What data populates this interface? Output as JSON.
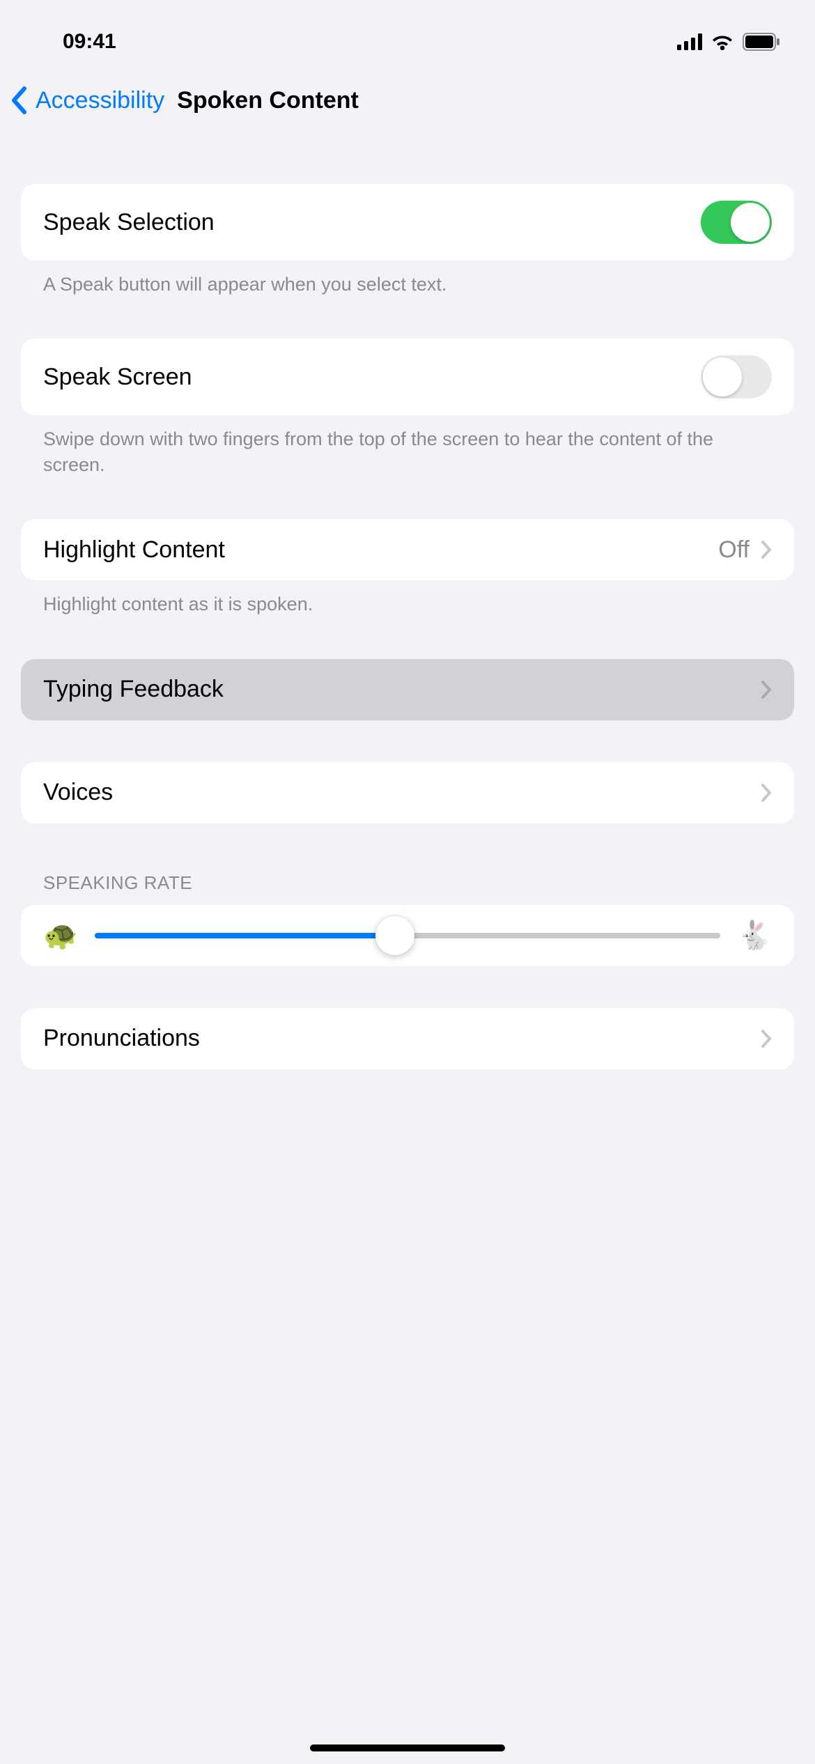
{
  "statusBar": {
    "time": "09:41"
  },
  "nav": {
    "backLabel": "Accessibility",
    "title": "Spoken Content"
  },
  "rows": {
    "speakSelection": {
      "label": "Speak Selection",
      "on": true,
      "footer": "A Speak button will appear when you select text."
    },
    "speakScreen": {
      "label": "Speak Screen",
      "on": false,
      "footer": "Swipe down with two fingers from the top of the screen to hear the content of the screen."
    },
    "highlightContent": {
      "label": "Highlight Content",
      "value": "Off",
      "footer": "Highlight content as it is spoken."
    },
    "typingFeedback": {
      "label": "Typing Feedback"
    },
    "voices": {
      "label": "Voices"
    },
    "speakingRate": {
      "header": "Speaking Rate",
      "percent": 48
    },
    "pronunciations": {
      "label": "Pronunciations"
    }
  }
}
